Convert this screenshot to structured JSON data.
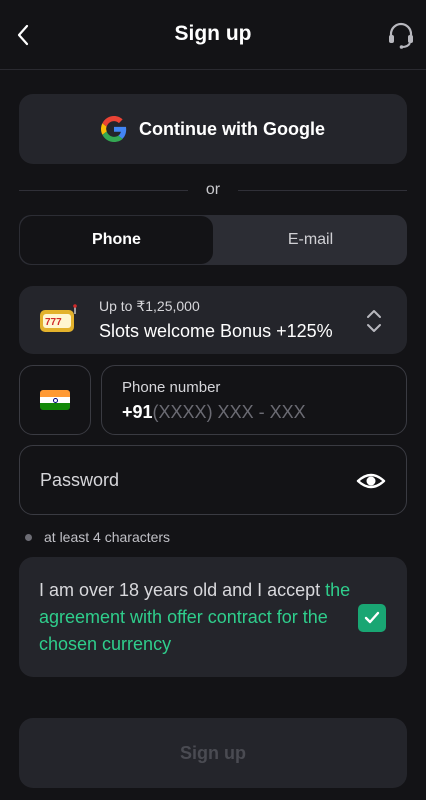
{
  "header": {
    "title": "Sign up",
    "back_icon": "chevron-left-icon",
    "support_icon": "headset-icon"
  },
  "google": {
    "label": "Continue with Google",
    "icon": "google-icon"
  },
  "divider": {
    "text": "or"
  },
  "tabs": [
    {
      "label": "Phone",
      "active": true
    },
    {
      "label": "E-mail",
      "active": false
    }
  ],
  "bonus": {
    "subtitle": "Up to ₹1,25,000",
    "title": "Slots welcome Bonus +125%",
    "icon": "slot-machine-icon"
  },
  "phone": {
    "country_flag": "india-flag-icon",
    "label": "Phone number",
    "code": "+91",
    "placeholder": "(XXXX) XXX - XXX"
  },
  "password": {
    "placeholder": "Password",
    "icon": "eye-icon"
  },
  "hint": {
    "text": "at least 4 characters"
  },
  "agreement": {
    "text": "I am over 18 years old and I accept ",
    "link": "the agreement with offer contract for the chosen currency",
    "checked": true
  },
  "submit": {
    "label": "Sign up"
  },
  "colors": {
    "background": "#131316",
    "card": "#24252b",
    "accent_green": "#2fce8c",
    "checkbox_green": "#19a673"
  }
}
